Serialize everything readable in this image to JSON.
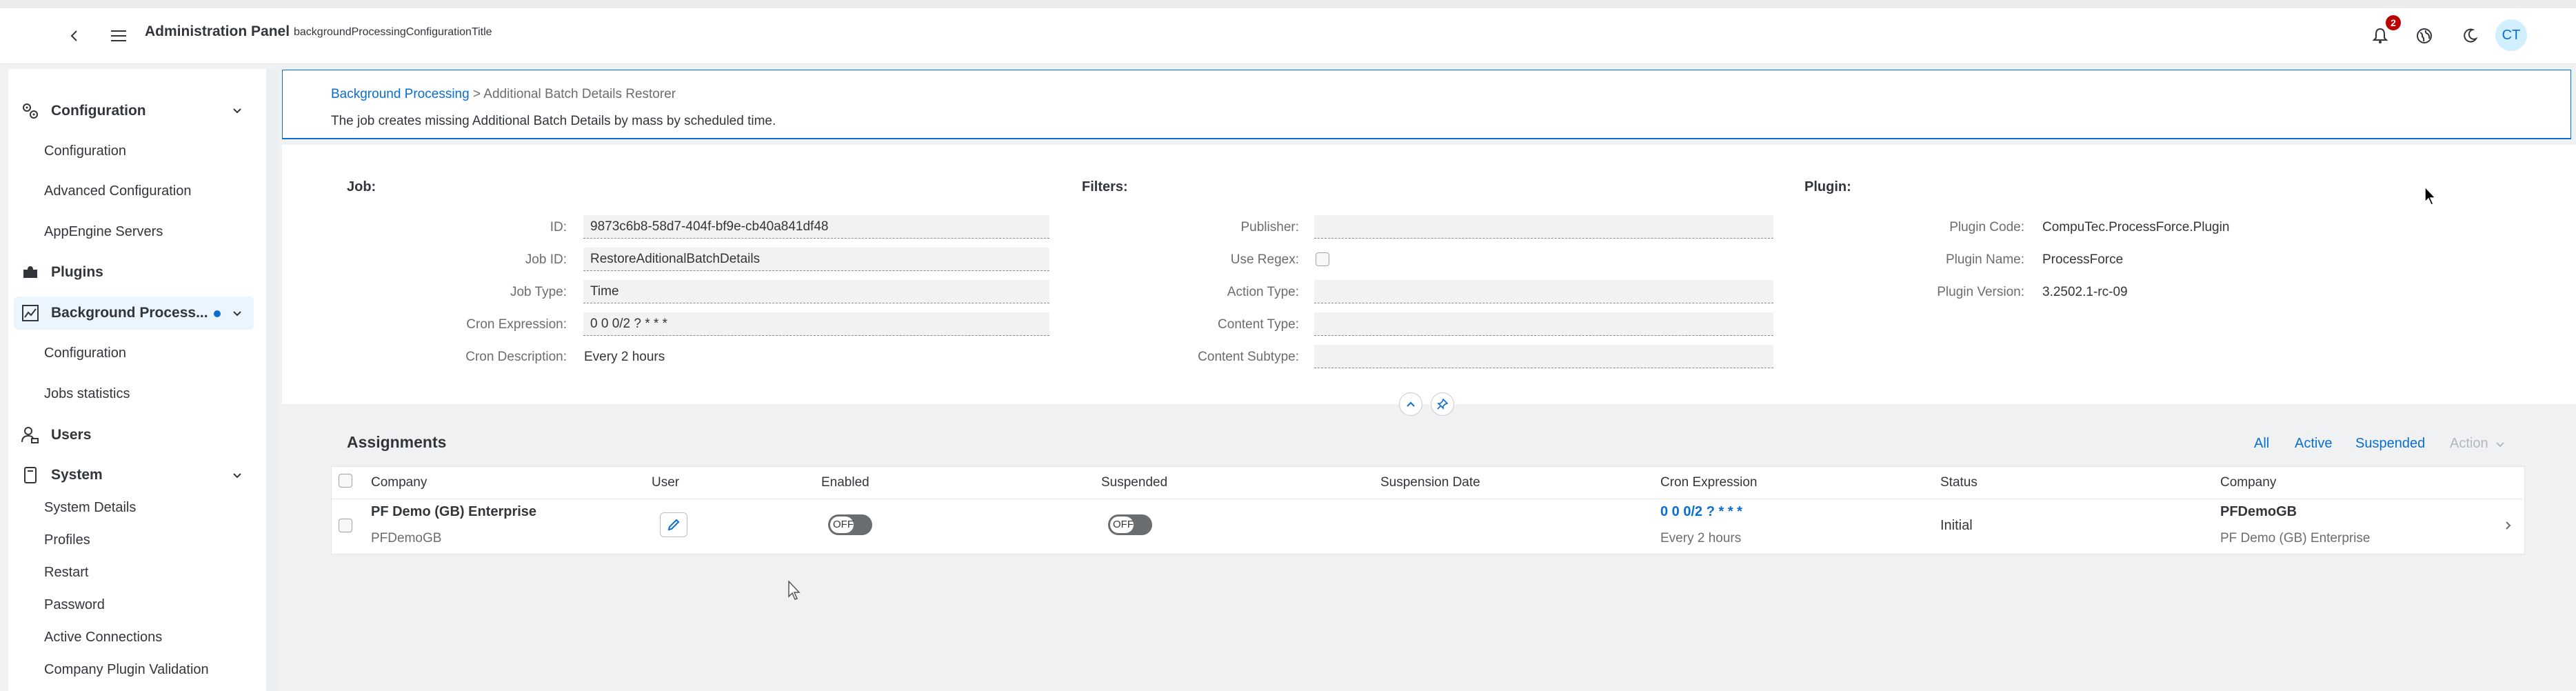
{
  "shell": {
    "title": "Administration Panel",
    "subtitle": "backgroundProcessingConfigurationTitle",
    "notification_count": "2",
    "avatar_initials": "CT"
  },
  "sidebar": {
    "groups": [
      {
        "label": "Configuration",
        "icon": "gears-icon",
        "items": [
          "Configuration",
          "Advanced Configuration",
          "AppEngine Servers"
        ]
      },
      {
        "label": "Plugins",
        "icon": "puzzle-icon",
        "items": []
      },
      {
        "label": "Background Process...",
        "icon": "process-chart-icon",
        "items": [
          "Configuration",
          "Jobs statistics"
        ]
      },
      {
        "label": "Users",
        "icon": "user-settings-icon",
        "items": []
      },
      {
        "label": "System",
        "icon": "device-icon",
        "items": [
          "System Details",
          "Profiles",
          "Restart",
          "Password",
          "Active Connections",
          "Company Plugin Validation"
        ]
      }
    ]
  },
  "header": {
    "breadcrumb_link": "Background Processing",
    "breadcrumb_sep": ">",
    "breadcrumb_current": "Additional Batch Details Restorer",
    "description": "The job creates missing Additional Batch Details by mass by scheduled time."
  },
  "job": {
    "title": "Job:",
    "id_label": "ID:",
    "id_value": "9873c6b8-58d7-404f-bf9e-cb40a841df48",
    "jobid_label": "Job ID:",
    "jobid_value": "RestoreAditionalBatchDetails",
    "type_label": "Job Type:",
    "type_value": "Time",
    "cron_label": "Cron Expression:",
    "cron_value": "0 0 0/2 ? * * *",
    "crondesc_label": "Cron Description:",
    "crondesc_value": "Every 2 hours"
  },
  "filters": {
    "title": "Filters:",
    "publisher_label": "Publisher:",
    "regex_label": "Use Regex:",
    "action_label": "Action Type:",
    "content_label": "Content Type:",
    "subtype_label": "Content Subtype:"
  },
  "plugin": {
    "title": "Plugin:",
    "code_label": "Plugin Code:",
    "code_value": "CompuTec.ProcessForce.Plugin",
    "name_label": "Plugin Name:",
    "name_value": "ProcessForce",
    "version_label": "Plugin Version:",
    "version_value": "3.2502.1-rc-09"
  },
  "assignments": {
    "title": "Assignments",
    "toolbar": {
      "all": "All",
      "active": "Active",
      "suspended": "Suspended",
      "action": "Action"
    },
    "columns": [
      "Company",
      "User",
      "Enabled",
      "Suspended",
      "Suspension Date",
      "Cron Expression",
      "Status",
      "Company"
    ],
    "rows": [
      {
        "company": "PF Demo (GB) Enterprise",
        "company_db": "PFDemoGB",
        "enabled": "OFF",
        "suspended": "OFF",
        "suspension_date": "",
        "cron": "0 0 0/2 ? * * *",
        "cron_desc": "Every 2 hours",
        "status": "Initial",
        "company2": "PFDemoGB",
        "company2_sub": "PF Demo (GB) Enterprise"
      }
    ]
  }
}
